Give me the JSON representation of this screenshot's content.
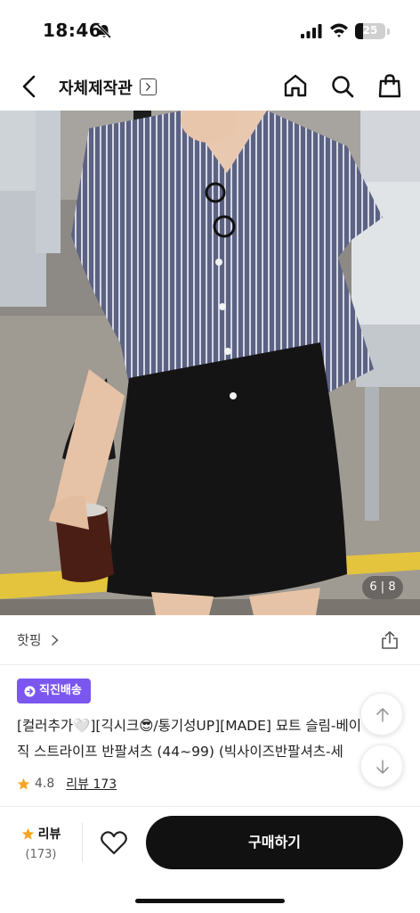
{
  "status_bar": {
    "time": "18:46",
    "battery_level": 25,
    "battery_text": "25"
  },
  "header": {
    "shop_name": "자체제작관",
    "icons": [
      "back-icon",
      "chevron-right-icon",
      "home-icon",
      "search-icon",
      "shopping-bag-icon"
    ]
  },
  "gallery": {
    "counter": "6 | 8"
  },
  "brand": {
    "name": "핫핑"
  },
  "product": {
    "badge": "직진배송",
    "title_line1": "[컬러추가🤍][긱시크😎/통기성UP][MADE] 묘트 슬림-베이",
    "title_line2": "직 스트라이프 반팔셔츠 (44~99) (빅사이즈반팔셔츠-세",
    "rating": "4.8",
    "review_link": "리뷰 173"
  },
  "bottom_bar": {
    "review_label": "리뷰",
    "review_count": "(173)",
    "buy_label": "구매하기"
  },
  "colors": {
    "badge": "#7b57f0",
    "star": "#f5a623",
    "buy_button": "#111111"
  }
}
